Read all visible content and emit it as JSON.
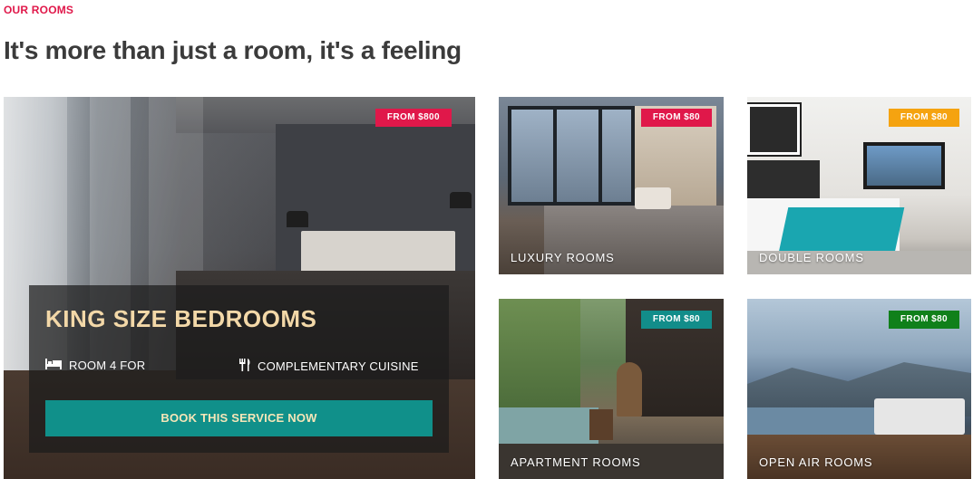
{
  "section": {
    "eyebrow": "OUR ROOMS",
    "headline": "It's more than just a room, it's a feeling"
  },
  "featured": {
    "badge": "FROM $800",
    "badge_color": "#e0184a",
    "title": "KING SIZE BEDROOMS",
    "meta_left_icon": "bed-icon",
    "meta_left": "ROOM 4 FOR",
    "meta_right_icon": "utensils-icon",
    "meta_right": "COMPLEMENTARY CUISINE",
    "button": "BOOK THIS SERVICE NOW",
    "button_color": "#10908a"
  },
  "rooms": [
    {
      "label": "LUXURY ROOMS",
      "badge": "FROM $80",
      "badge_color": "#e0184a"
    },
    {
      "label": "DOUBLE ROOMS",
      "badge": "FROM $80",
      "badge_color": "#f5a310"
    },
    {
      "label": "APARTMENT ROOMS",
      "badge": "FROM $80",
      "badge_color": "#128d8a"
    },
    {
      "label": "OPEN AIR ROOMS",
      "badge": "FROM $80",
      "badge_color": "#10801a"
    }
  ]
}
